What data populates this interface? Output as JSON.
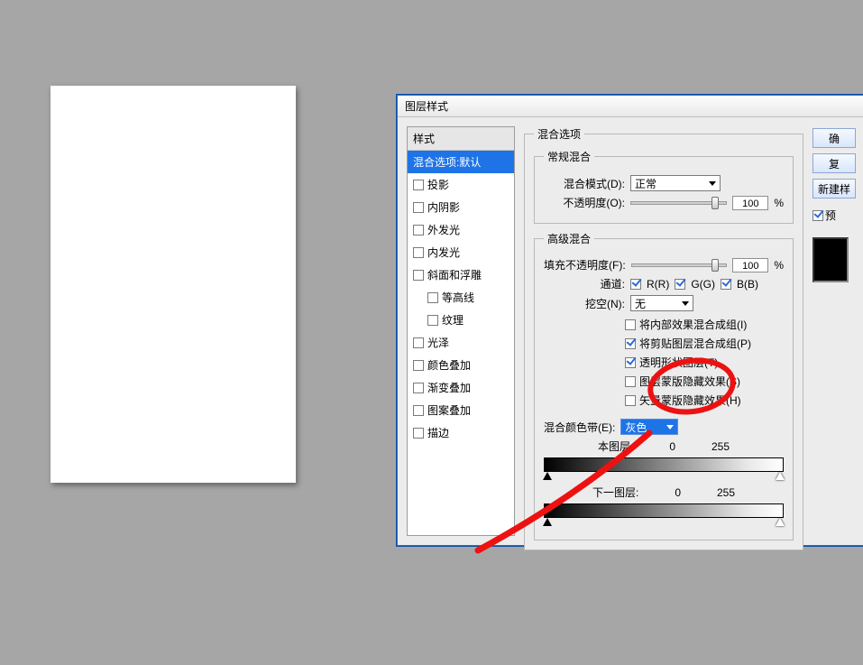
{
  "dialog_title": "图层样式",
  "styles": {
    "header": "样式",
    "items": [
      {
        "label": "混合选项:默认",
        "selected": true,
        "checkbox": false
      },
      {
        "label": "投影",
        "checkbox": true,
        "checked": false
      },
      {
        "label": "内阴影",
        "checkbox": true,
        "checked": false
      },
      {
        "label": "外发光",
        "checkbox": true,
        "checked": false
      },
      {
        "label": "内发光",
        "checkbox": true,
        "checked": false
      },
      {
        "label": "斜面和浮雕",
        "checkbox": true,
        "checked": false
      },
      {
        "label": "等高线",
        "checkbox": true,
        "checked": false,
        "indent": true
      },
      {
        "label": "纹理",
        "checkbox": true,
        "checked": false,
        "indent": true
      },
      {
        "label": "光泽",
        "checkbox": true,
        "checked": false
      },
      {
        "label": "颜色叠加",
        "checkbox": true,
        "checked": false
      },
      {
        "label": "渐变叠加",
        "checkbox": true,
        "checked": false
      },
      {
        "label": "图案叠加",
        "checkbox": true,
        "checked": false
      },
      {
        "label": "描边",
        "checkbox": true,
        "checked": false
      }
    ]
  },
  "blend": {
    "group": "混合选项",
    "general_group": "常规混合",
    "mode_label": "混合模式(D):",
    "mode_value": "正常",
    "opacity_label": "不透明度(O):",
    "opacity_value": "100",
    "pct": "%"
  },
  "adv": {
    "group": "高级混合",
    "fill_label": "填充不透明度(F):",
    "fill_value": "100",
    "pct": "%",
    "channel_label": "通道:",
    "ch_r": "R(R)",
    "ch_g": "G(G)",
    "ch_b": "B(B)",
    "knockout_label": "挖空(N):",
    "knockout_value": "无",
    "opts": [
      {
        "label": "将内部效果混合成组(I)",
        "checked": false
      },
      {
        "label": "将剪贴图层混合成组(P)",
        "checked": true
      },
      {
        "label": "透明形状图层(T)",
        "checked": true
      },
      {
        "label": "图层蒙版隐藏效果(S)",
        "checked": false
      },
      {
        "label": "矢量蒙版隐藏效果(H)",
        "checked": false
      }
    ]
  },
  "blendif": {
    "label": "混合颜色带(E):",
    "value": "灰色",
    "this_label": "本图层:",
    "this_lo": "0",
    "this_hi": "255",
    "under_label": "下一图层:",
    "under_lo": "0",
    "under_hi": "255"
  },
  "side": {
    "ok": "确",
    "cancel": "复",
    "newstyle": "新建样",
    "preview": "预"
  }
}
